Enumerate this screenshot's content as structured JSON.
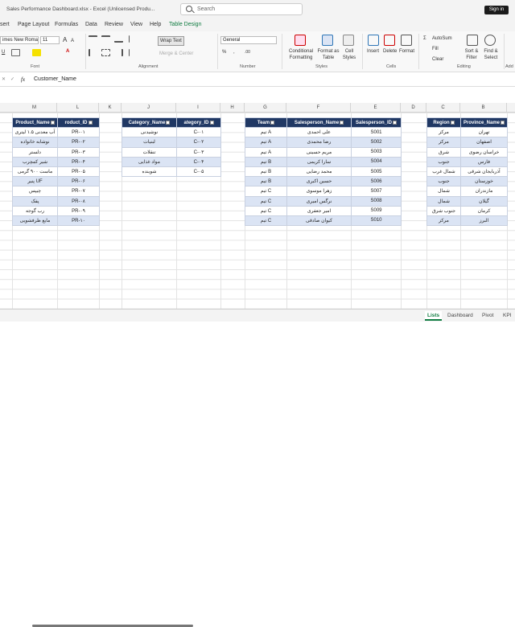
{
  "window": {
    "title": "Sales Performance Dashboard.xlsx  -  Excel (Unlicensed Produ...",
    "search_placeholder": "Search",
    "signin": "Sign in"
  },
  "tabs": [
    "sert",
    "Page Layout",
    "Formulas",
    "Data",
    "Review",
    "View",
    "Help",
    "Table Design"
  ],
  "ribbon": {
    "font_name": "imes New Roman",
    "font_size": "11",
    "wrap_text": "Wrap Text",
    "merge_center": "Merge & Center",
    "number_format": "General",
    "conditional_formatting": "Conditional Formatting",
    "format_as_table": "Format as Table",
    "cell_styles": "Cell Styles",
    "insert": "Insert",
    "delete": "Delete",
    "format": "Format",
    "autosum": "AutoSum",
    "fill": "Fill",
    "clear": "Clear",
    "sort_filter": "Sort & Filter",
    "find_select": "Find & Select",
    "group_font": "Font",
    "group_alignment": "Alignment",
    "group_number": "Number",
    "group_styles": "Styles",
    "group_cells": "Cells",
    "group_editing": "Editing",
    "group_add": "Add"
  },
  "formula": {
    "fx": "fx",
    "content": "Customer_Name"
  },
  "columns": [
    "M",
    "L",
    "K",
    "J",
    "I",
    "H",
    "G",
    "F",
    "E",
    "D",
    "C",
    "B"
  ],
  "product_table": {
    "headers": [
      "Product_Name",
      "roduct_ID"
    ],
    "rows": [
      [
        "آب معدنی ۱.۵ لیتری",
        "PR-۰۱"
      ],
      [
        "نوشابه خانواده",
        "PR-۰۲"
      ],
      [
        "دلستر",
        "PR-۰۳"
      ],
      [
        "شیر کمچرب",
        "PR-۰۴"
      ],
      [
        "ماست ۹۰۰ گرمی",
        "PR-۰۵"
      ],
      [
        "پنیر UF",
        "PR-۰۶"
      ],
      [
        "چیپس",
        "PR-۰۷"
      ],
      [
        "پفک",
        "PR-۰۸"
      ],
      [
        "رب گوجه",
        "PR-۰۹"
      ],
      [
        "مایع ظرفشویی",
        "PR-۱۰"
      ]
    ]
  },
  "category_table": {
    "headers": [
      "Category_Name",
      "ategory_ID"
    ],
    "rows": [
      [
        "نوشیدنی",
        "C-۰۱"
      ],
      [
        "لبنیات",
        "C-۰۲"
      ],
      [
        "تنقلات",
        "C-۰۳"
      ],
      [
        "مواد غذایی",
        "C-۰۴"
      ],
      [
        "شوینده",
        "C-۰۵"
      ]
    ]
  },
  "salesperson_table": {
    "headers": [
      "Team",
      "Salesperson_Name",
      "Salesperson_ID"
    ],
    "rows": [
      [
        "تیم A",
        "علی احمدی",
        "S001"
      ],
      [
        "تیم A",
        "رضا محمدی",
        "S002"
      ],
      [
        "تیم A",
        "مریم حسینی",
        "S003"
      ],
      [
        "تیم B",
        "سارا کریمی",
        "S004"
      ],
      [
        "تیم B",
        "محمد رضایی",
        "S005"
      ],
      [
        "تیم B",
        "حسین اکبری",
        "S006"
      ],
      [
        "تیم C",
        "زهرا موسوی",
        "S007"
      ],
      [
        "تیم C",
        "نرگس امیری",
        "S008"
      ],
      [
        "تیم C",
        "امیر جعفری",
        "S009"
      ],
      [
        "تیم C",
        "کیوان صادقی",
        "S010"
      ]
    ]
  },
  "province_table": {
    "headers": [
      "Region",
      "Province_Name"
    ],
    "rows": [
      [
        "مرکز",
        "تهران"
      ],
      [
        "مرکز",
        "اصفهان"
      ],
      [
        "شرق",
        "خراسان رضوی"
      ],
      [
        "جنوب",
        "فارس"
      ],
      [
        "شمال غرب",
        "آذربایجان شرقی"
      ],
      [
        "جنوب",
        "خوزستان"
      ],
      [
        "شمال",
        "مازندران"
      ],
      [
        "شمال",
        "گیلان"
      ],
      [
        "جنوب شرق",
        "کرمان"
      ],
      [
        "مرکز",
        "البرز"
      ]
    ]
  },
  "sheet_tabs": [
    "Lists",
    "Dashboard",
    "Pivot",
    "KPI"
  ]
}
